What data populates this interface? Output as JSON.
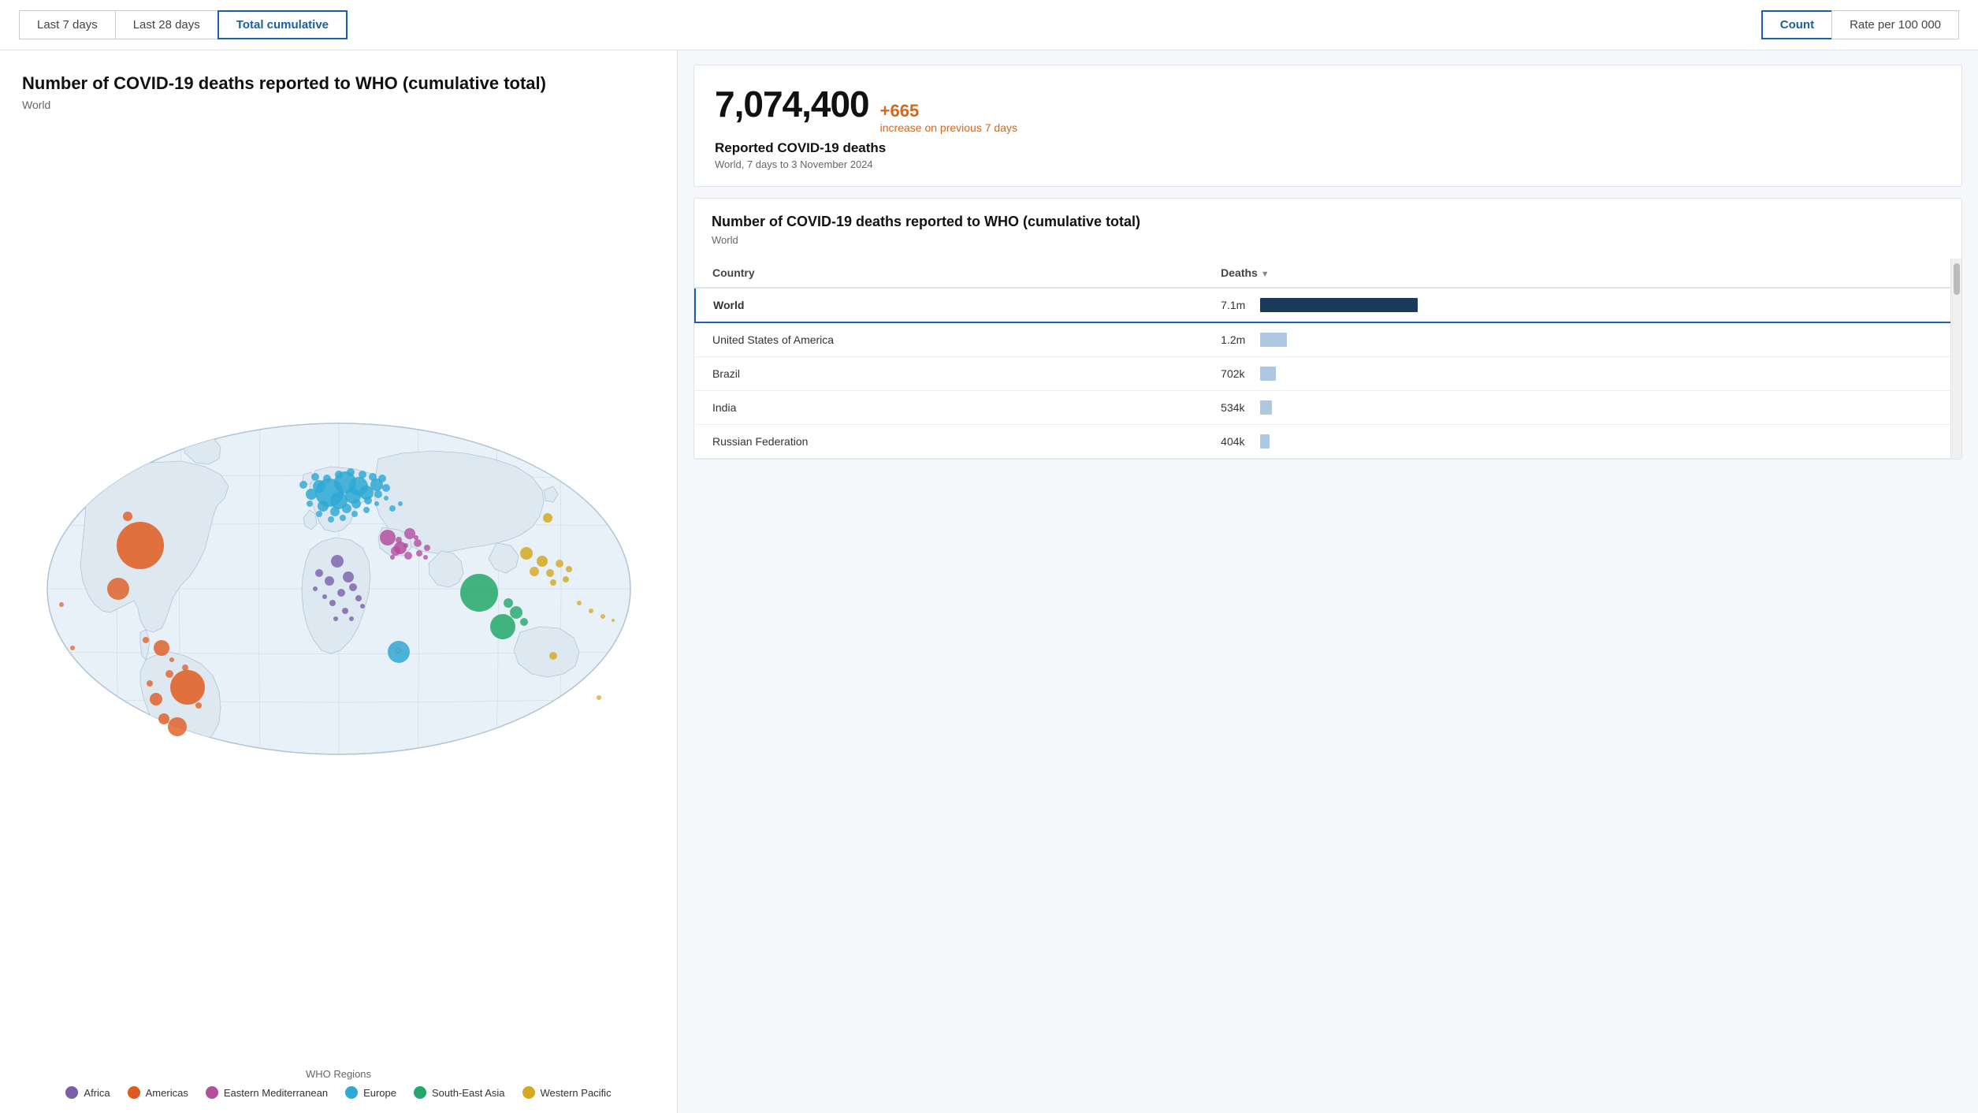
{
  "topbar": {
    "time_tabs": [
      {
        "id": "last7",
        "label": "Last 7 days",
        "active": false
      },
      {
        "id": "last28",
        "label": "Last 28 days",
        "active": false
      },
      {
        "id": "cumulative",
        "label": "Total cumulative",
        "active": true
      }
    ],
    "view_tabs": [
      {
        "id": "count",
        "label": "Count",
        "active": true
      },
      {
        "id": "rate",
        "label": "Rate per 100 000",
        "active": false
      }
    ]
  },
  "chart": {
    "title": "Number of COVID-19 deaths reported to WHO (cumulative total)",
    "region": "World"
  },
  "legend": {
    "title": "WHO Regions",
    "items": [
      {
        "label": "Africa",
        "color": "#7b5ea7"
      },
      {
        "label": "Americas",
        "color": "#e05a1e"
      },
      {
        "label": "Eastern Mediterranean",
        "color": "#b44fa0"
      },
      {
        "label": "Europe",
        "color": "#2fa8d5"
      },
      {
        "label": "South-East Asia",
        "color": "#22a86a"
      },
      {
        "label": "Western Pacific",
        "color": "#d4a820"
      }
    ]
  },
  "stat_card": {
    "number": "7,074,400",
    "delta": "+665",
    "delta_label": "increase on previous 7 days",
    "label": "Reported COVID-19 deaths",
    "desc": "World, 7 days to 3 November 2024"
  },
  "table_card": {
    "title": "Number of COVID-19 deaths reported to WHO (cumulative total)",
    "region": "World",
    "col_country": "Country",
    "col_deaths": "Deaths",
    "rows": [
      {
        "country": "World",
        "value": "7.1m",
        "bar_pct": 100,
        "bar_color": "#1a3a5c",
        "is_world": true
      },
      {
        "country": "United States of America",
        "value": "1.2m",
        "bar_pct": 17,
        "bar_color": "#adc8e0",
        "is_world": false
      },
      {
        "country": "Brazil",
        "value": "702k",
        "bar_pct": 10,
        "bar_color": "#adc8e0",
        "is_world": false
      },
      {
        "country": "India",
        "value": "534k",
        "bar_pct": 7.5,
        "bar_color": "#adc8e0",
        "is_world": false
      },
      {
        "country": "Russian Federation",
        "value": "404k",
        "bar_pct": 5.7,
        "bar_color": "#adc8e0",
        "is_world": false
      }
    ]
  }
}
